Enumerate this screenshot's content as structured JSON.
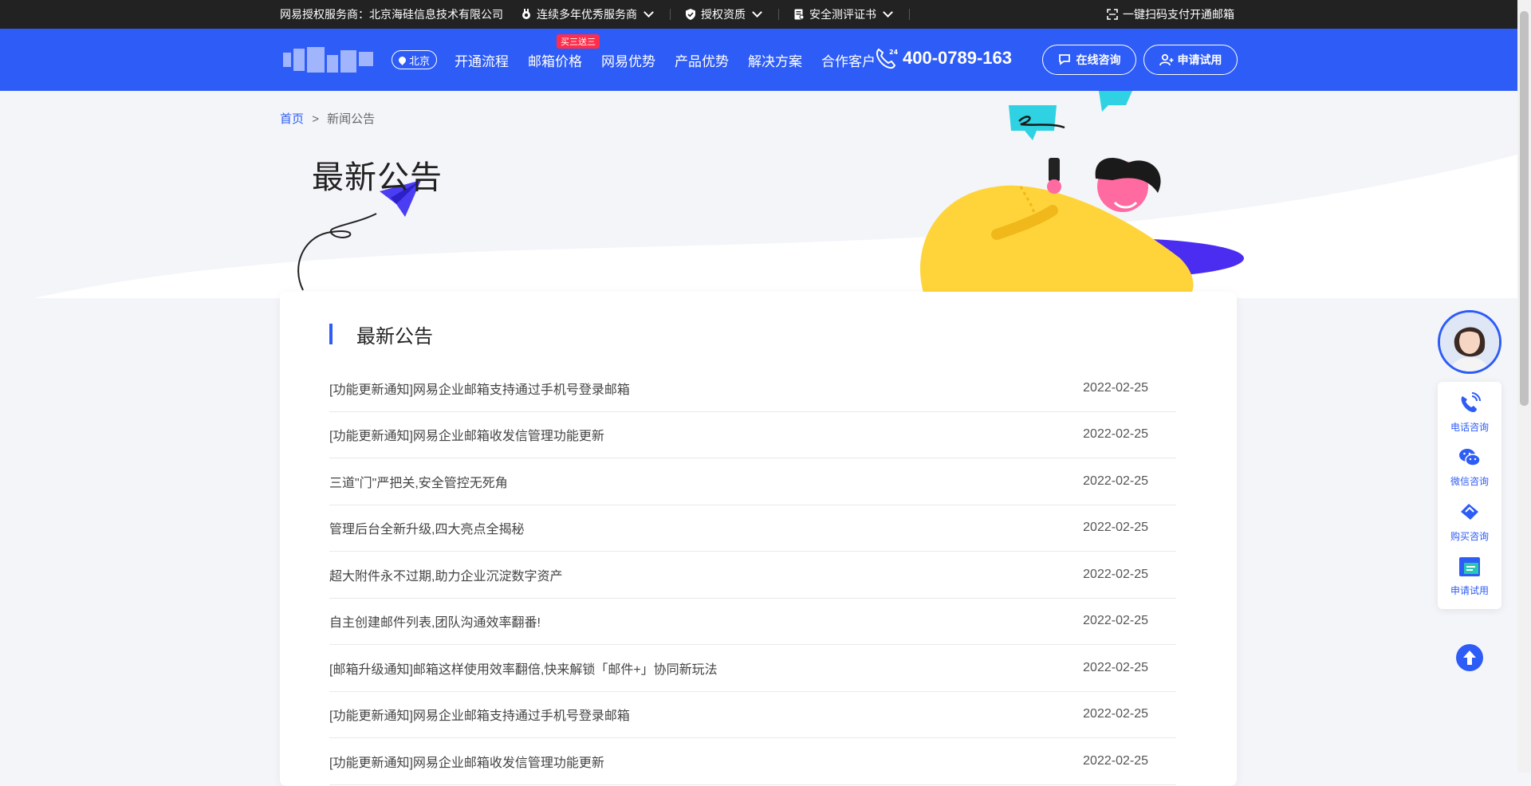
{
  "topbar": {
    "provider": "网易授权服务商：北京海硅信息技术有限公司",
    "award": "连续多年优秀服务商",
    "license": "授权资质",
    "security": "安全测评证书",
    "scan_pay": "一键扫码支付开通邮箱"
  },
  "nav": {
    "city": "北京",
    "menu": [
      "开通流程",
      "邮箱价格",
      "网易优势",
      "产品优势",
      "解决方案",
      "合作客户"
    ],
    "promo_badge": "买三送三",
    "phone": "400-0789-163",
    "consult_button": "在线咨询",
    "trial_button": "申请试用"
  },
  "breadcrumb": {
    "home": "首页",
    "separator": ">",
    "current": "新闻公告"
  },
  "hero": {
    "title": "最新公告"
  },
  "card": {
    "title": "最新公告"
  },
  "news": [
    {
      "title": "[功能更新通知]网易企业邮箱支持通过手机号登录邮箱",
      "date": "2022-02-25"
    },
    {
      "title": "[功能更新通知]网易企业邮箱收发信管理功能更新",
      "date": "2022-02-25"
    },
    {
      "title": "三道\"门\"严把关,安全管控无死角",
      "date": "2022-02-25"
    },
    {
      "title": "管理后台全新升级,四大亮点全揭秘",
      "date": "2022-02-25"
    },
    {
      "title": "超大附件永不过期,助力企业沉淀数字资产",
      "date": "2022-02-25"
    },
    {
      "title": "自主创建邮件列表,团队沟通效率翻番!",
      "date": "2022-02-25"
    },
    {
      "title": "[邮箱升级通知]邮箱这样使用效率翻倍,快来解锁「邮件+」协同新玩法",
      "date": "2022-02-25"
    },
    {
      "title": "[功能更新通知]网易企业邮箱支持通过手机号登录邮箱",
      "date": "2022-02-25"
    },
    {
      "title": "[功能更新通知]网易企业邮箱收发信管理功能更新",
      "date": "2022-02-25"
    }
  ],
  "side": {
    "phone": "电话咨询",
    "wechat": "微信咨询",
    "purchase": "购买咨询",
    "trial": "申请试用"
  },
  "colors": {
    "brand": "#2d5cf6",
    "topbar": "#222222",
    "badge": "#ff2d4a",
    "yellow": "#ffd43b"
  }
}
